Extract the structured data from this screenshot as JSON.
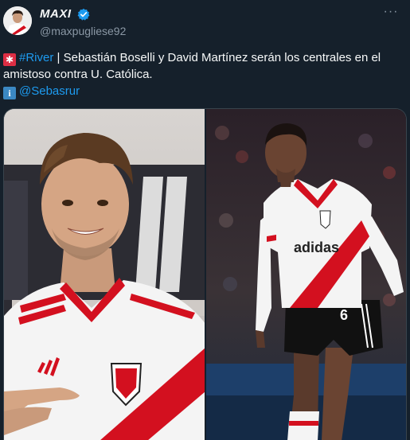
{
  "account": {
    "display_name": "MAXI",
    "handle": "@maxpugliese92",
    "verified": true,
    "avatar": "avatar-photo"
  },
  "menu": {
    "more_icon": "more-horizontal-icon"
  },
  "tweet": {
    "line1_emoji": "rotating-light-icon",
    "hashtag": "#River",
    "text": " | Sebastián Boselli y David Martínez serán los centrales en el amistoso contra U. Católica.",
    "line2_emoji": "information-icon",
    "mention": "@Sebasrur"
  },
  "media": {
    "left_photo": "sebastian-boselli-photo",
    "right_photo": "david-martinez-photo",
    "right_jersey_text": "adidas",
    "right_jersey_number": "6"
  },
  "colors": {
    "background": "#15202b",
    "text": "#f7f9f9",
    "secondary": "#8b98a5",
    "link": "#1d9bf0",
    "river_red": "#d3101f"
  }
}
